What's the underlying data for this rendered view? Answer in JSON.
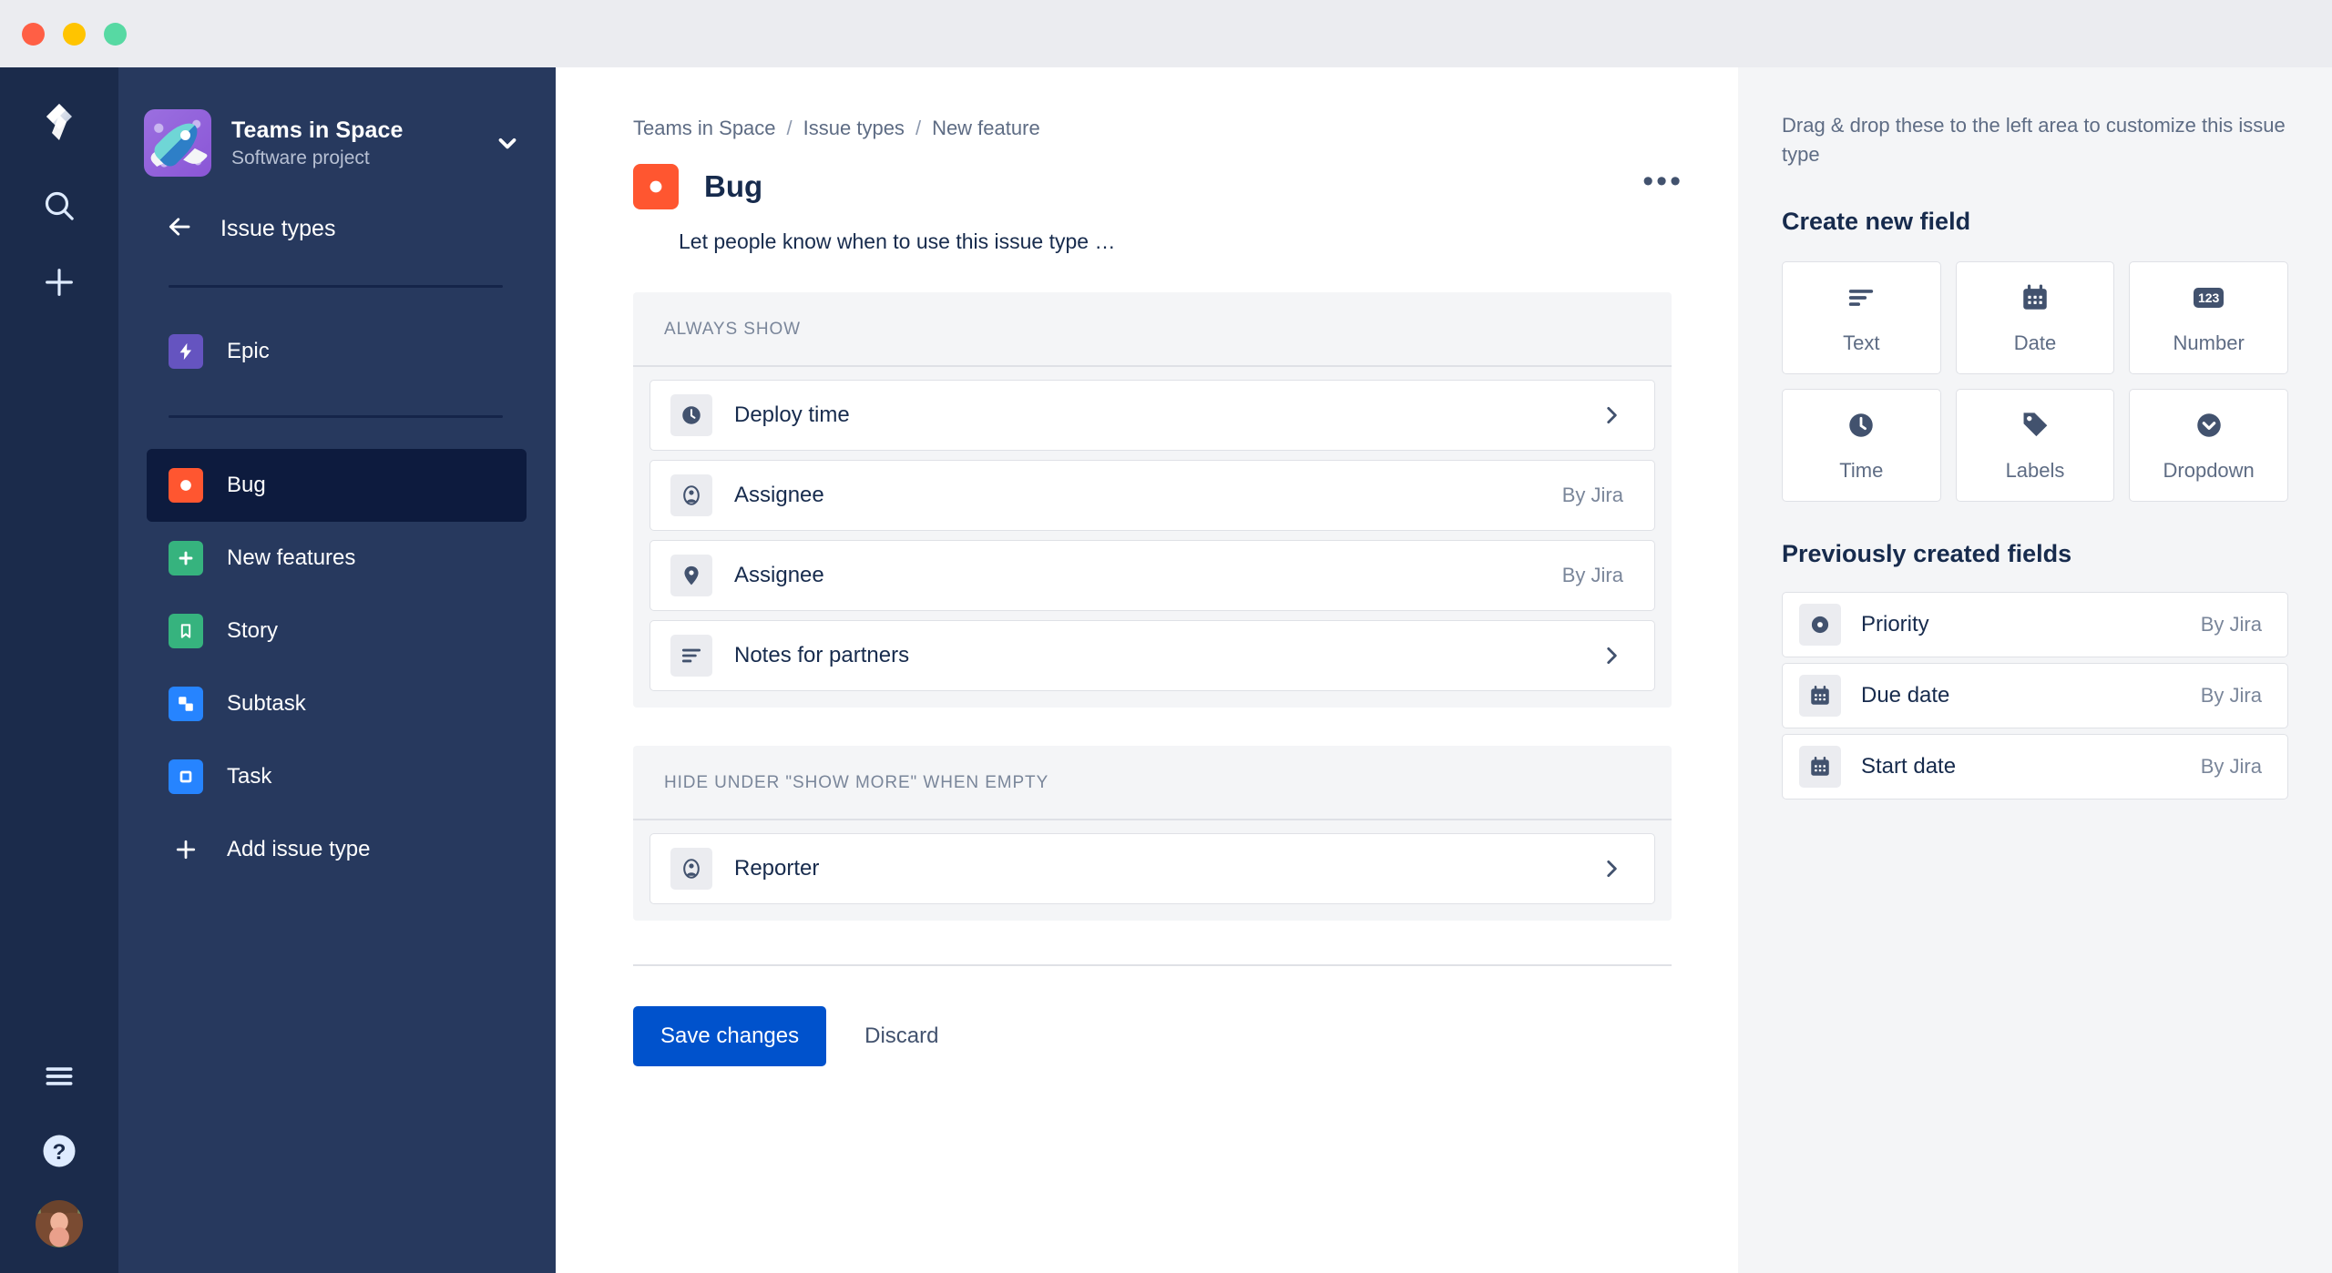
{
  "window": {
    "traffic_lights": [
      "close",
      "minimize",
      "maximize"
    ]
  },
  "global_nav": {
    "logo_icon": "jira-logo-icon",
    "items": [
      {
        "icon": "search-icon",
        "name": "search"
      },
      {
        "icon": "plus-icon",
        "name": "create"
      }
    ],
    "bottom_items": [
      {
        "icon": "menu-icon",
        "name": "app-switcher"
      },
      {
        "icon": "help-icon",
        "name": "help"
      },
      {
        "icon": "avatar",
        "name": "profile-avatar"
      }
    ]
  },
  "sidebar": {
    "project_name": "Teams in Space",
    "project_type": "Software project",
    "switcher_icon": "chevron-down-icon",
    "back_icon": "arrow-left-icon",
    "back_label": "Issue types",
    "epic_group": [
      {
        "label": "Epic",
        "icon": "epic-icon",
        "color": "#6554C0",
        "selected": false
      }
    ],
    "issue_types": [
      {
        "label": "Bug",
        "icon": "bug-icon",
        "color": "#FF5630",
        "selected": true
      },
      {
        "label": "New features",
        "icon": "new-feature-icon",
        "color": "#36B37E",
        "selected": false
      },
      {
        "label": "Story",
        "icon": "story-icon",
        "color": "#36B37E",
        "selected": false
      },
      {
        "label": "Subtask",
        "icon": "subtask-icon",
        "color": "#2684FF",
        "selected": false
      },
      {
        "label": "Task",
        "icon": "task-icon",
        "color": "#2684FF",
        "selected": false
      }
    ],
    "add_issue_type_label": "Add issue type",
    "add_issue_type_icon": "plus-icon"
  },
  "main": {
    "breadcrumb": [
      "Teams in Space",
      "Issue types",
      "New feature"
    ],
    "breadcrumb_separator": "/",
    "issue_type_title": "Bug",
    "issue_type_icon": "bug-icon",
    "more_actions_icon": "more-horizontal-icon",
    "more_actions_label": "•••",
    "description": "Let people know when to use this issue type …",
    "sections": [
      {
        "heading": "ALWAYS SHOW",
        "fields": [
          {
            "name": "Deploy time",
            "icon": "clock-icon",
            "meta": "",
            "chevron": true
          },
          {
            "name": "Assignee",
            "icon": "user-circle-icon",
            "meta": "By Jira",
            "chevron": false
          },
          {
            "name": "Assignee",
            "icon": "tag-icon",
            "meta": "By Jira",
            "chevron": false
          },
          {
            "name": "Notes for partners",
            "icon": "text-lines-icon",
            "meta": "",
            "chevron": true
          }
        ]
      },
      {
        "heading": "HIDE UNDER \"SHOW MORE\" WHEN EMPTY",
        "fields": [
          {
            "name": "Reporter",
            "icon": "user-circle-icon",
            "meta": "",
            "chevron": true
          }
        ]
      }
    ],
    "save_label": "Save changes",
    "discard_label": "Discard",
    "save_color": "#0052CC"
  },
  "right_panel": {
    "hint": "Drag & drop these to the left area to customize this issue type",
    "create_title": "Create new field",
    "field_types": [
      {
        "label": "Text",
        "icon": "text-lines-icon"
      },
      {
        "label": "Date",
        "icon": "calendar-icon"
      },
      {
        "label": "Number",
        "icon": "number-123-icon",
        "badge": "123"
      },
      {
        "label": "Time",
        "icon": "clock-icon"
      },
      {
        "label": "Labels",
        "icon": "tag-icon"
      },
      {
        "label": "Dropdown",
        "icon": "chevron-down-circle-icon"
      }
    ],
    "previous_title": "Previously created fields",
    "previous_fields": [
      {
        "label": "Priority",
        "icon": "priority-icon",
        "meta": "By Jira"
      },
      {
        "label": "Due date",
        "icon": "calendar-icon",
        "meta": "By Jira"
      },
      {
        "label": "Start date",
        "icon": "calendar-icon",
        "meta": "By Jira"
      }
    ]
  }
}
